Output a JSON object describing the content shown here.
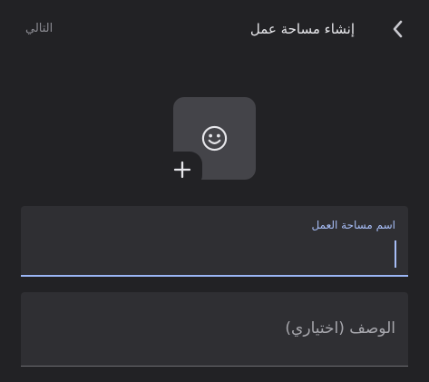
{
  "header": {
    "title": "إنشاء مساحة عمل",
    "next_label": "التالي",
    "back_icon": "chevron-left-icon"
  },
  "avatar": {
    "icon": "smiley-icon",
    "add_icon": "plus-icon"
  },
  "form": {
    "name_label": "اسم مساحة العمل",
    "name_value": "",
    "description_placeholder": "الوصف (اختياري)"
  },
  "colors": {
    "background": "#222225",
    "field_background": "#2f2f33",
    "accent": "#a7bdf6",
    "avatar_background": "#444449"
  }
}
